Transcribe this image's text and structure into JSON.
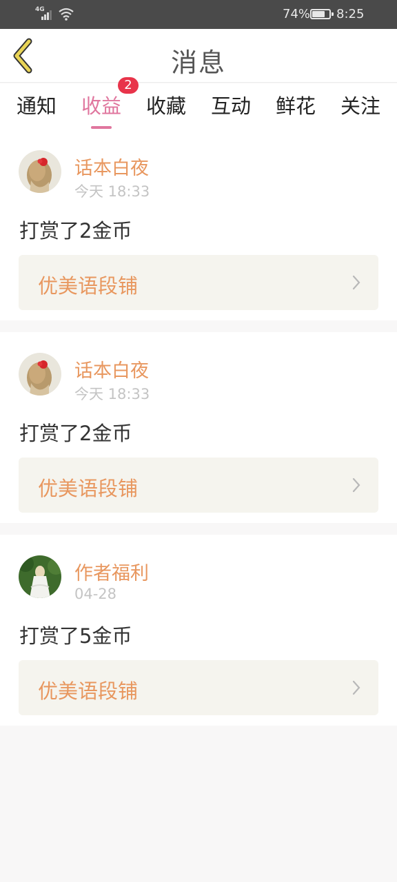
{
  "status_bar": {
    "network": "4G",
    "battery_percent": "74%",
    "battery_level": 0.74,
    "time": "8:25"
  },
  "header": {
    "title": "消息",
    "back_icon": "chevron-left-icon"
  },
  "tabs": [
    {
      "label": "通知",
      "active": false
    },
    {
      "label": "收益",
      "active": true,
      "badge": "2"
    },
    {
      "label": "收藏",
      "active": false
    },
    {
      "label": "互动",
      "active": false
    },
    {
      "label": "鲜花",
      "active": false
    },
    {
      "label": "关注",
      "active": false
    }
  ],
  "messages": [
    {
      "username": "话本白夜",
      "time": "今天 18:33",
      "text": "打赏了2金币",
      "link": "优美语段铺"
    },
    {
      "username": "话本白夜",
      "time": "今天 18:33",
      "text": "打赏了2金币",
      "link": "优美语段铺"
    },
    {
      "username": "作者福利",
      "time": "04-28",
      "text": "打赏了5金币",
      "link": "优美语段铺"
    }
  ],
  "colors": {
    "accent_pink": "#e0769e",
    "name_orange": "#e8975f",
    "badge_red": "#e8344a",
    "back_yellow": "#e9d456"
  }
}
